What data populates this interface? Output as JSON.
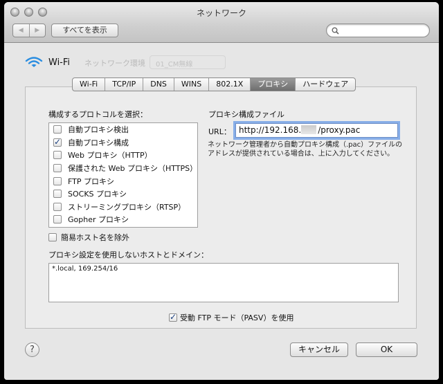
{
  "window": {
    "title": "ネットワーク"
  },
  "toolbar": {
    "back": "◀",
    "forward": "▶",
    "show_all": "すべてを表示",
    "search_placeholder": ""
  },
  "background": {
    "interface": "Wi-Fi",
    "network_name_label": "ネットワーク環境",
    "network_location": "01_CM無線"
  },
  "tabs": [
    {
      "label": "Wi-Fi",
      "active": false
    },
    {
      "label": "TCP/IP",
      "active": false
    },
    {
      "label": "DNS",
      "active": false
    },
    {
      "label": "WINS",
      "active": false
    },
    {
      "label": "802.1X",
      "active": false
    },
    {
      "label": "プロキシ",
      "active": true
    },
    {
      "label": "ハードウェア",
      "active": false
    }
  ],
  "protocols": {
    "heading": "構成するプロトコルを選択：",
    "items": [
      {
        "label": "自動プロキシ検出",
        "checked": false
      },
      {
        "label": "自動プロキシ構成",
        "checked": true
      },
      {
        "label": "Web プロキシ（HTTP）",
        "checked": false
      },
      {
        "label": "保護された Web プロキシ（HTTPS）",
        "checked": false
      },
      {
        "label": "FTP プロキシ",
        "checked": false
      },
      {
        "label": "SOCKS プロキシ",
        "checked": false
      },
      {
        "label": "ストリーミングプロキシ（RTSP）",
        "checked": false
      },
      {
        "label": "Gopher プロキシ",
        "checked": false
      }
    ]
  },
  "proxy_file": {
    "heading": "プロキシ構成ファイル",
    "url_label": "URL：",
    "url_prefix": "http://192.168.",
    "url_suffix": "/proxy.pac",
    "description": "ネットワーク管理者から自動プロキシ構成（.pac）ファイルのアドレスが提供されている場合は、上に入力してください。"
  },
  "simple_hosts": {
    "label": "簡易ホスト名を除外",
    "checked": false
  },
  "bypass": {
    "heading": "プロキシ設定を使用しないホストとドメイン：",
    "value": "*.local, 169.254/16"
  },
  "pasv": {
    "label": "受動 FTP モード（PASV）を使用",
    "checked": true
  },
  "buttons": {
    "help": "?",
    "cancel": "キャンセル",
    "ok": "OK"
  }
}
